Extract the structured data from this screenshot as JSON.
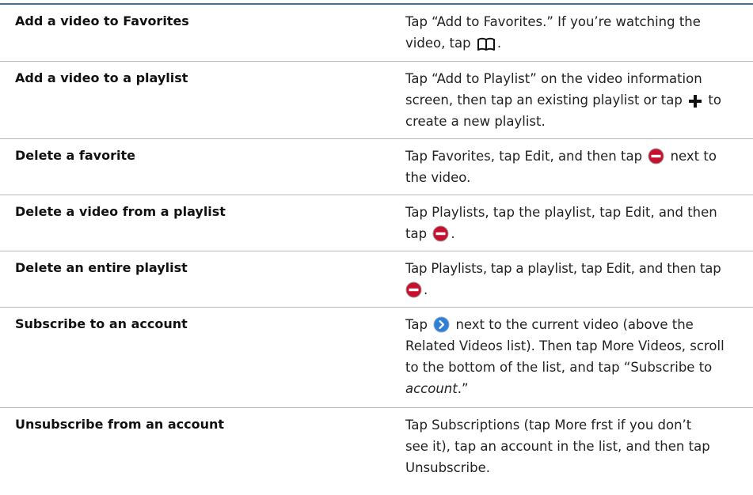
{
  "rows": [
    {
      "task": "Add a video to Favorites",
      "instr": [
        "Tap “Add to Favorites.” If you’re watching the",
        "video, tap",
        "."
      ],
      "icon": "bookmarks-icon"
    },
    {
      "task": "Add a video to a playlist",
      "instr": [
        "Tap “Add to Playlist” on the video information",
        "screen, then tap an existing playlist or tap",
        "to",
        "create a new playlist."
      ],
      "icon": "plus-icon"
    },
    {
      "task": "Delete a favorite",
      "instr": [
        "Tap Favorites, tap Edit, and then tap",
        "next to",
        "the video."
      ],
      "icon": "delete-icon"
    },
    {
      "task": "Delete a video from a playlist",
      "instr": [
        "Tap Playlists, tap the playlist, tap Edit, and then",
        "tap",
        "."
      ],
      "icon": "delete-icon"
    },
    {
      "task": "Delete an entire playlist",
      "instr": [
        "Tap Playlists, tap a playlist, tap Edit, and then tap",
        "."
      ],
      "icon": "delete-icon"
    },
    {
      "task": "Subscribe to an account",
      "instr": [
        "Tap",
        "next to the current video (above the",
        "Related Videos list). Then tap More Videos, scroll",
        "to the bottom of the list, and tap “Subscribe to",
        "account",
        ".”"
      ],
      "icon": "detail-disclosure-icon"
    },
    {
      "task": "Unsubscribe from an account",
      "instr": [
        "Tap Subscriptions (tap More frst if you don’t",
        "see it), tap an account in the list, and then tap",
        "Unsubscribe."
      ]
    }
  ],
  "colors": {
    "rule": "#4d6f8c",
    "divider": "#b9b9b9",
    "delete_red": "#c8102e",
    "disclosure_blue": "#2f7fd6"
  }
}
